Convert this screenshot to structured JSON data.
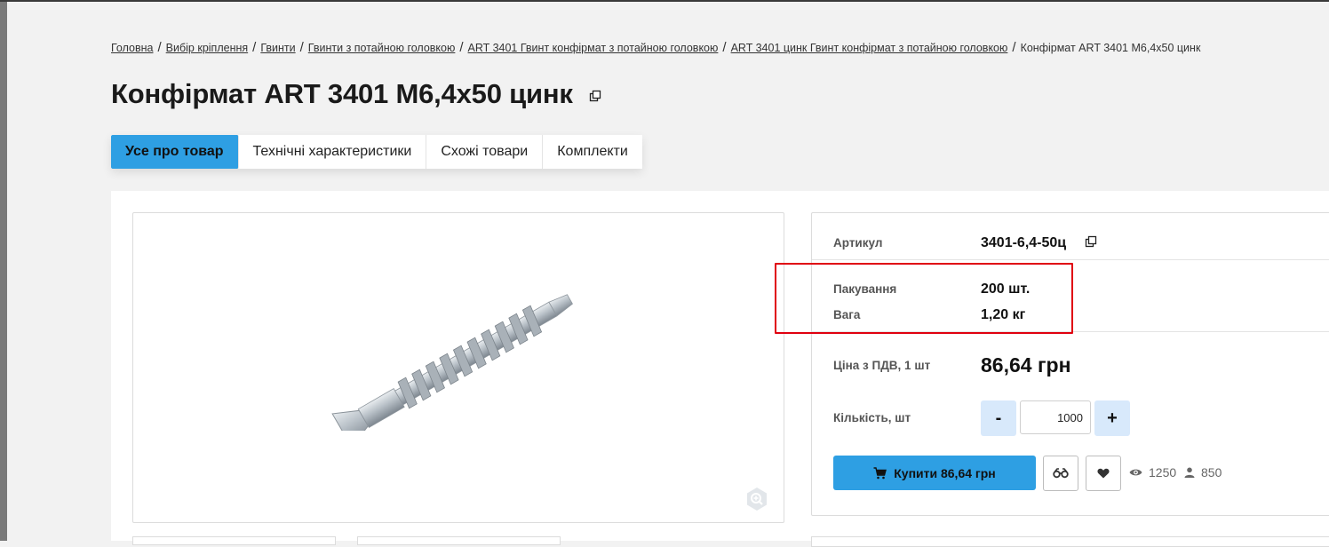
{
  "breadcrumb": {
    "items": [
      "Головна",
      "Вибір кріплення",
      "Гвинти",
      "Гвинти з потайною головкою",
      "ART 3401 Гвинт конфірмат з потайною головкою",
      "ART 3401 цинк Гвинт конфірмат з потайною головкою"
    ],
    "current": "Конфірмат ART 3401 M6,4x50 цинк",
    "separator": "/"
  },
  "page": {
    "title": "Конфірмат ART 3401 M6,4x50 цинк"
  },
  "tabs": [
    "Усе про товар",
    "Технічні характеристики",
    "Схожі товари",
    "Комплекти"
  ],
  "product": {
    "sku_label": "Артикул",
    "sku_value": "3401-6,4-50ц",
    "packaging_label": "Пакування",
    "packaging_value": "200 шт.",
    "weight_label": "Вага",
    "weight_value": "1,20 кг",
    "price_label": "Ціна з ПДВ, 1 шт",
    "price_value": "86,64 грн",
    "quantity_label": "Кількість, шт",
    "quantity_value": "1000",
    "minus_label": "-",
    "plus_label": "+",
    "buy_label": "Купити 86,64 грн",
    "views_count": "1250",
    "buyers_count": "850"
  },
  "icons": {
    "copy": "copy-icon",
    "zoom": "zoom-in-icon",
    "cart": "cart-icon",
    "compare": "compare-icon",
    "favorite": "heart-icon",
    "views": "eye-icon",
    "users": "user-icon"
  },
  "colors": {
    "accent": "#2e9fe3",
    "qty_button": "#d8e9fb",
    "highlight_border": "#e0000f",
    "background": "#f2f2f2"
  }
}
